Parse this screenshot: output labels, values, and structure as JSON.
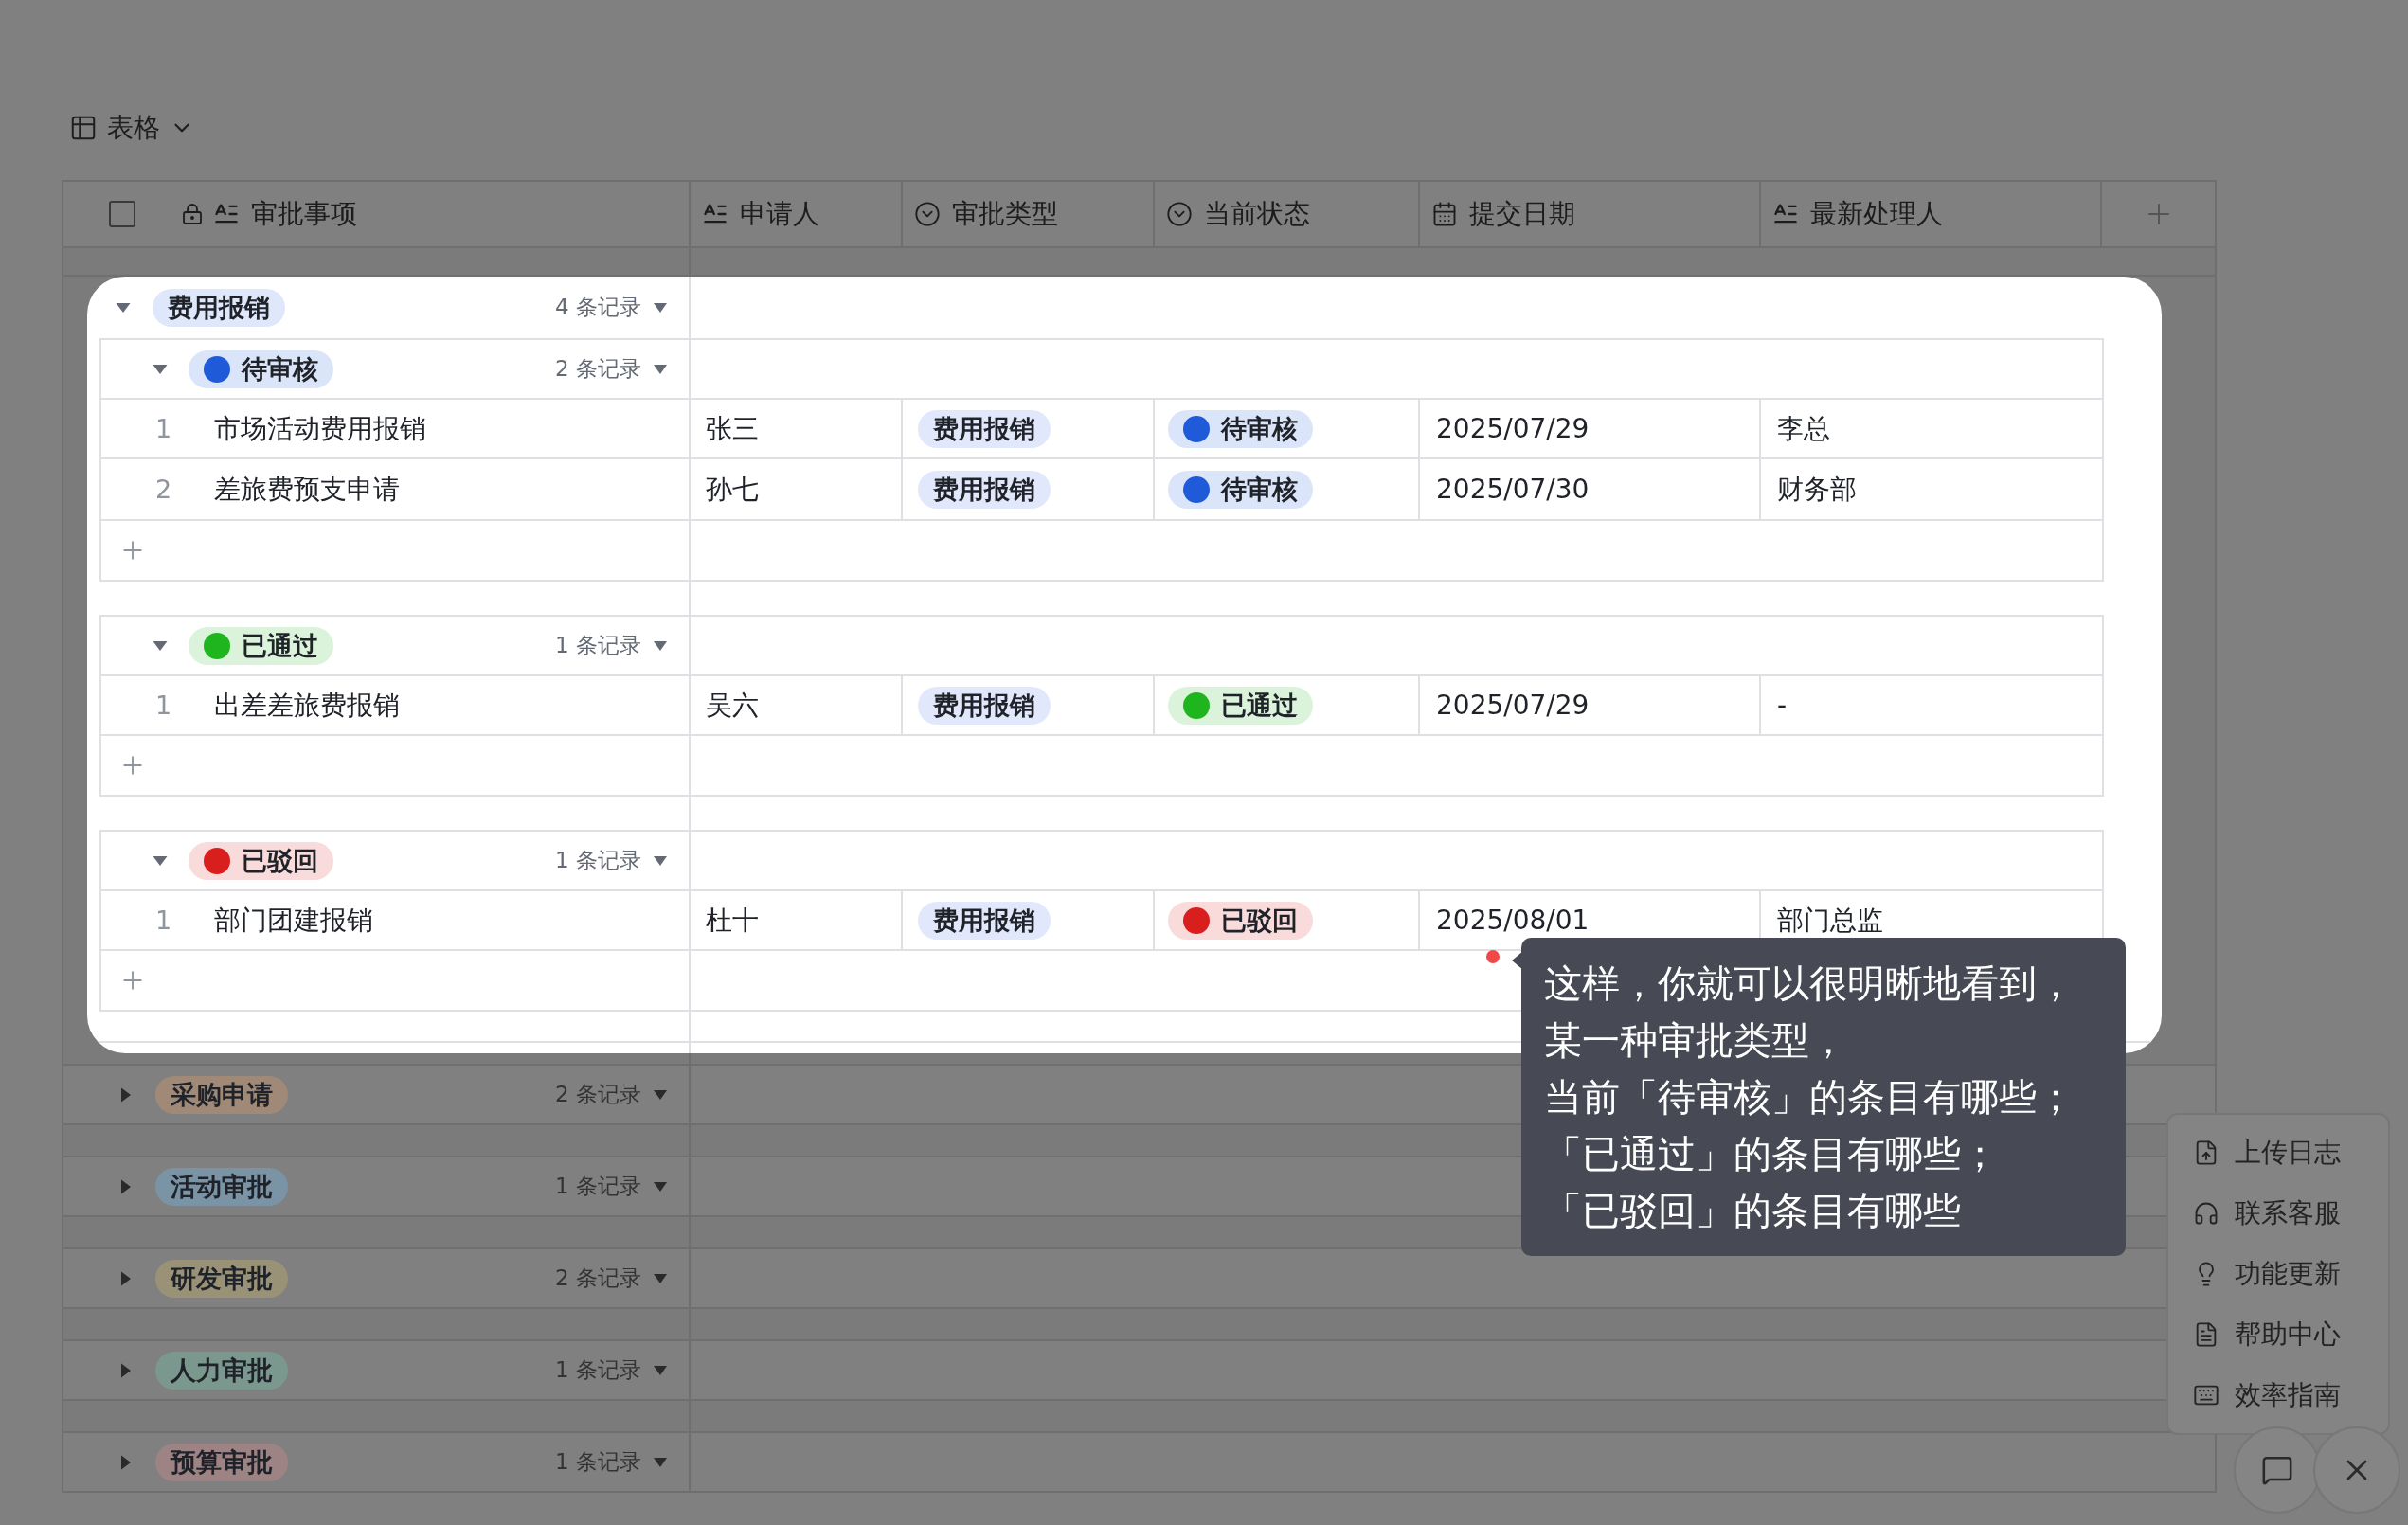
{
  "toolbar": {
    "view_label": "表格"
  },
  "select_all": {
    "checked": false
  },
  "columns": [
    {
      "label": "审批事项",
      "kind": "text",
      "locked": true
    },
    {
      "label": "申请人",
      "kind": "text",
      "locked": false
    },
    {
      "label": "审批类型",
      "kind": "select",
      "locked": false
    },
    {
      "label": "当前状态",
      "kind": "select",
      "locked": false
    },
    {
      "label": "提交日期",
      "kind": "date",
      "locked": false
    },
    {
      "label": "最新处理人",
      "kind": "text",
      "locked": false
    }
  ],
  "groups": [
    {
      "label": "费用报销",
      "count": "4 条记录",
      "color": "#dfe7fb",
      "highlighted": true,
      "expanded": true,
      "subgroups": [
        {
          "label": "待审核",
          "count": "2 条记录",
          "color": "#1f5bd8",
          "expanded": true,
          "rows": [
            {
              "number": "1",
              "item": "市场活动费用报销",
              "applicant": "张三",
              "type": "费用报销",
              "status": {
                "label": "待审核",
                "color": "#1f5bd8"
              },
              "date": "2025/07/29",
              "handler": "李总"
            },
            {
              "number": "2",
              "item": "差旅费预支申请",
              "applicant": "孙七",
              "type": "费用报销",
              "status": {
                "label": "待审核",
                "color": "#1f5bd8"
              },
              "date": "2025/07/30",
              "handler": "财务部"
            }
          ]
        },
        {
          "label": "已通过",
          "count": "1 条记录",
          "color": "#1fb51f",
          "expanded": true,
          "rows": [
            {
              "number": "1",
              "item": "出差差旅费报销",
              "applicant": "吴六",
              "type": "费用报销",
              "status": {
                "label": "已通过",
                "color": "#1fb51f"
              },
              "date": "2025/07/29",
              "handler": "-"
            }
          ]
        },
        {
          "label": "已驳回",
          "count": "1 条记录",
          "color": "#d91e1e",
          "expanded": true,
          "rows": [
            {
              "number": "1",
              "item": "部门团建报销",
              "applicant": "杜十",
              "type": "费用报销",
              "status": {
                "label": "已驳回",
                "color": "#d91e1e"
              },
              "date": "2025/08/01",
              "handler": "部门总监"
            }
          ]
        }
      ]
    },
    {
      "label": "采购申请",
      "count": "2 条记录",
      "color": "#a08a77",
      "highlighted": false,
      "expanded": false
    },
    {
      "label": "活动审批",
      "count": "1 条记录",
      "color": "#7a93a5",
      "highlighted": false,
      "expanded": false
    },
    {
      "label": "研发审批",
      "count": "2 条记录",
      "color": "#9a9276",
      "highlighted": false,
      "expanded": false
    },
    {
      "label": "人力审批",
      "count": "1 条记录",
      "color": "#7a988e",
      "highlighted": false,
      "expanded": false
    },
    {
      "label": "预算审批",
      "count": "1 条记录",
      "color": "#9d8383",
      "highlighted": false,
      "expanded": false
    }
  ],
  "tooltip": {
    "lines": [
      "这样，你就可以很明晰地看到，",
      "某一种审批类型，",
      "当前「待审核」的条目有哪些；",
      "「已通过」的条目有哪些；",
      "「已驳回」的条目有哪些"
    ]
  },
  "help_menu": [
    {
      "label": "上传日志",
      "kind": "upload"
    },
    {
      "label": "联系客服",
      "kind": "support"
    },
    {
      "label": "功能更新",
      "kind": "updates"
    },
    {
      "label": "帮助中心",
      "kind": "help"
    },
    {
      "label": "效率指南",
      "kind": "guide"
    }
  ],
  "floating_buttons": [
    {
      "kind": "message"
    },
    {
      "kind": "close"
    }
  ]
}
